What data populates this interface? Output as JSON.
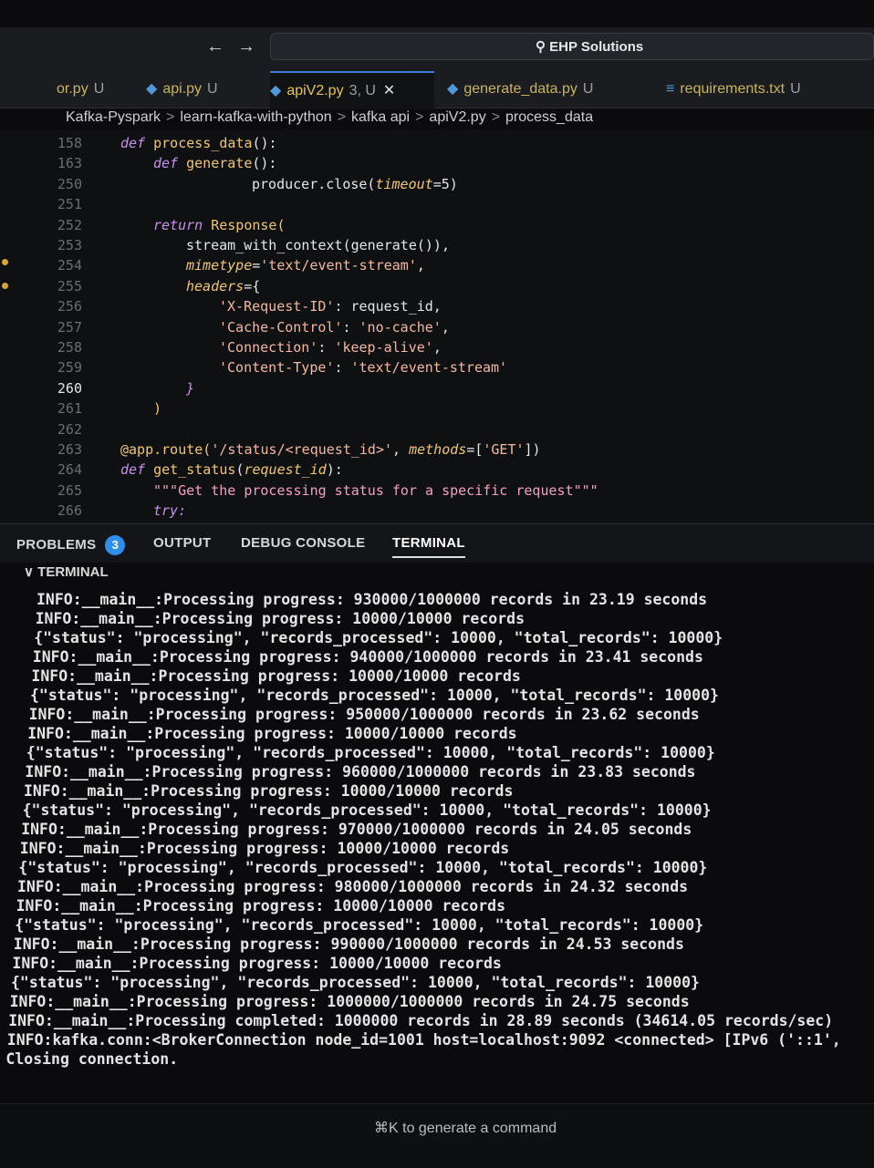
{
  "window": {
    "search_text": "EHP Solutions"
  },
  "tabs": [
    {
      "label": "or.py",
      "status": "U"
    },
    {
      "label": "api.py",
      "status": "U"
    },
    {
      "label": "apiV2.py",
      "status": "3, U",
      "active": true
    },
    {
      "label": "generate_data.py",
      "status": "U"
    },
    {
      "label": "requirements.txt",
      "status": "U"
    }
  ],
  "breadcrumb": [
    "Kafka-Pyspark",
    "learn-kafka-with-python",
    "kafka api",
    "apiV2.py",
    "process_data"
  ],
  "code_lines": [
    {
      "n": "158",
      "indent": 1,
      "tokens": [
        [
          "kw",
          "def "
        ],
        [
          "fn",
          "process_data"
        ],
        [
          "plain",
          "():"
        ]
      ]
    },
    {
      "n": "163",
      "indent": 2,
      "tokens": [
        [
          "kw",
          "def "
        ],
        [
          "fn",
          "generate"
        ],
        [
          "plain",
          "():"
        ]
      ]
    },
    {
      "n": "250",
      "indent": 5,
      "tokens": [
        [
          "plain",
          "producer.close("
        ],
        [
          "param",
          "timeout"
        ],
        [
          "plain",
          "=5)"
        ]
      ]
    },
    {
      "n": "251",
      "indent": 0,
      "tokens": []
    },
    {
      "n": "252",
      "indent": 2,
      "tokens": [
        [
          "kw",
          "return "
        ],
        [
          "fn",
          "Response("
        ]
      ]
    },
    {
      "n": "253",
      "indent": 3,
      "tokens": [
        [
          "plain",
          "stream_with_context(generate()),"
        ]
      ]
    },
    {
      "n": "254",
      "indent": 3,
      "tokens": [
        [
          "param",
          "mimetype"
        ],
        [
          "plain",
          "="
        ],
        [
          "str",
          "'text/event-stream'"
        ],
        [
          "plain",
          ","
        ]
      ]
    },
    {
      "n": "255",
      "indent": 3,
      "tokens": [
        [
          "param",
          "headers"
        ],
        [
          "plain",
          "={"
        ]
      ]
    },
    {
      "n": "256",
      "indent": 4,
      "tokens": [
        [
          "str",
          "'X-Request-ID'"
        ],
        [
          "plain",
          ": request_id,"
        ]
      ]
    },
    {
      "n": "257",
      "indent": 4,
      "tokens": [
        [
          "str",
          "'Cache-Control'"
        ],
        [
          "plain",
          ": "
        ],
        [
          "str",
          "'no-cache'"
        ],
        [
          "plain",
          ","
        ]
      ]
    },
    {
      "n": "258",
      "indent": 4,
      "tokens": [
        [
          "str",
          "'Connection'"
        ],
        [
          "plain",
          ": "
        ],
        [
          "str",
          "'keep-alive'"
        ],
        [
          "plain",
          ","
        ]
      ]
    },
    {
      "n": "259",
      "indent": 4,
      "tokens": [
        [
          "str",
          "'Content-Type'"
        ],
        [
          "plain",
          ": "
        ],
        [
          "str",
          "'text/event-stream'"
        ]
      ]
    },
    {
      "n": "260",
      "indent": 3,
      "tokens": [
        [
          "kw",
          "}"
        ]
      ],
      "current": true
    },
    {
      "n": "261",
      "indent": 2,
      "tokens": [
        [
          "fn",
          ")"
        ]
      ]
    },
    {
      "n": "262",
      "indent": 0,
      "tokens": []
    },
    {
      "n": "263",
      "indent": 1,
      "tokens": [
        [
          "fn",
          "@app.route("
        ],
        [
          "str",
          "'/status/<request_id>'"
        ],
        [
          "plain",
          ", "
        ],
        [
          "param",
          "methods"
        ],
        [
          "plain",
          "=["
        ],
        [
          "str",
          "'GET'"
        ],
        [
          "plain",
          "])"
        ]
      ]
    },
    {
      "n": "264",
      "indent": 1,
      "tokens": [
        [
          "kw",
          "def "
        ],
        [
          "fn",
          "get_status"
        ],
        [
          "plain",
          "("
        ],
        [
          "param",
          "request_id"
        ],
        [
          "plain",
          "):"
        ]
      ]
    },
    {
      "n": "265",
      "indent": 2,
      "tokens": [
        [
          "doc",
          "\"\"\"Get the processing status for a specific request\"\"\""
        ]
      ]
    },
    {
      "n": "266",
      "indent": 2,
      "tokens": [
        [
          "kw",
          "try:"
        ]
      ]
    }
  ],
  "panel": {
    "problems_label": "PROBLEMS",
    "problems_count": "3",
    "output_label": "OUTPUT",
    "debug_label": "DEBUG CONSOLE",
    "terminal_label": "TERMINAL",
    "terminal_section": "TERMINAL"
  },
  "terminal_lines": [
    "INFO:__main__:Processing progress: 930000/1000000 records in 23.19 seconds",
    "INFO:__main__:Processing progress: 10000/10000 records",
    "{\"status\": \"processing\", \"records_processed\": 10000, \"total_records\": 10000}",
    "INFO:__main__:Processing progress: 940000/1000000 records in 23.41 seconds",
    "INFO:__main__:Processing progress: 10000/10000 records",
    "{\"status\": \"processing\", \"records_processed\": 10000, \"total_records\": 10000}",
    "INFO:__main__:Processing progress: 950000/1000000 records in 23.62 seconds",
    "INFO:__main__:Processing progress: 10000/10000 records",
    "{\"status\": \"processing\", \"records_processed\": 10000, \"total_records\": 10000}",
    "INFO:__main__:Processing progress: 960000/1000000 records in 23.83 seconds",
    "INFO:__main__:Processing progress: 10000/10000 records",
    "{\"status\": \"processing\", \"records_processed\": 10000, \"total_records\": 10000}",
    "INFO:__main__:Processing progress: 970000/1000000 records in 24.05 seconds",
    "INFO:__main__:Processing progress: 10000/10000 records",
    "{\"status\": \"processing\", \"records_processed\": 10000, \"total_records\": 10000}",
    "INFO:__main__:Processing progress: 980000/1000000 records in 24.32 seconds",
    "INFO:__main__:Processing progress: 10000/10000 records",
    "{\"status\": \"processing\", \"records_processed\": 10000, \"total_records\": 10000}",
    "INFO:__main__:Processing progress: 990000/1000000 records in 24.53 seconds",
    "INFO:__main__:Processing progress: 10000/10000 records",
    "{\"status\": \"processing\", \"records_processed\": 10000, \"total_records\": 10000}",
    "INFO:__main__:Processing progress: 1000000/1000000 records in 24.75 seconds",
    "INFO:__main__:Processing completed: 1000000 records in 28.89 seconds (34614.05 records/sec)",
    "INFO:kafka.conn:<BrokerConnection node_id=1001 host=localhost:9092 <connected> [IPv6 ('::1',",
    "Closing connection."
  ],
  "footer": {
    "hint": "⌘K to generate a command"
  }
}
